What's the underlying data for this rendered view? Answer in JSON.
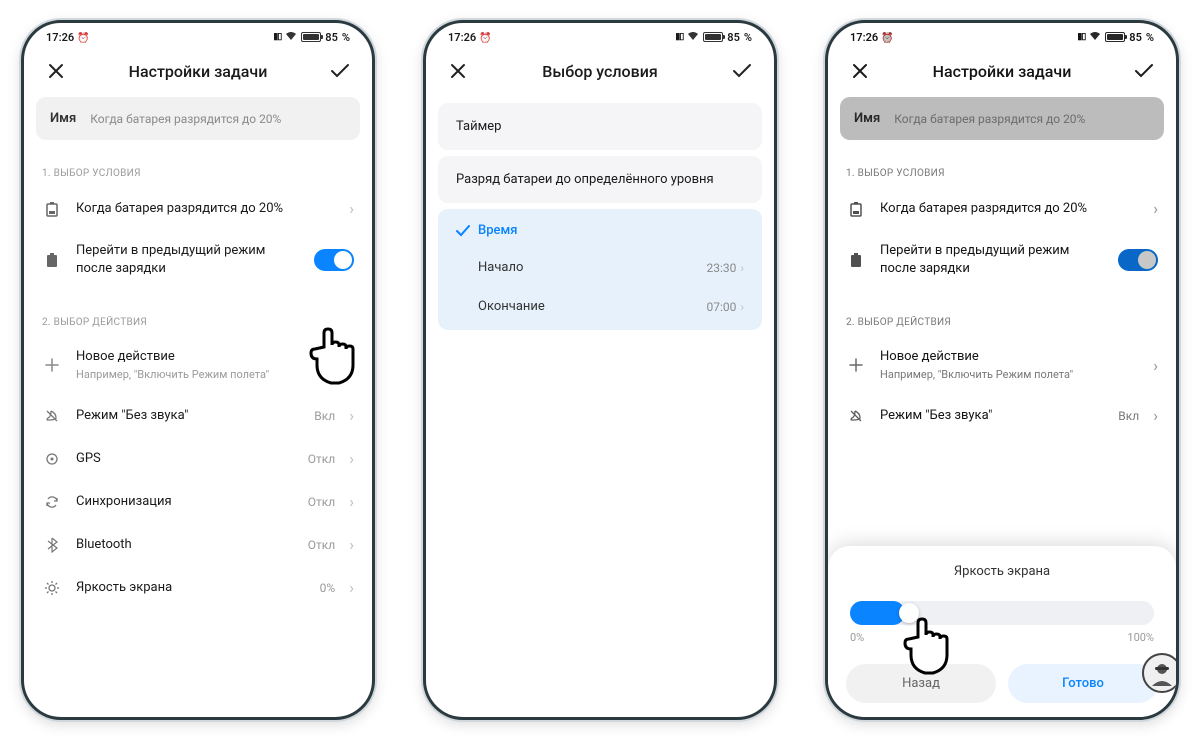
{
  "status": {
    "time": "17:26",
    "battery_pct": "85",
    "battery_suffix": "%"
  },
  "screen1": {
    "title": "Настройки задачи",
    "name_label": "Имя",
    "name_value": "Когда батарея разрядится до 20%",
    "section1": "1. ВЫБОР УСЛОВИЯ",
    "cond_text": "Когда батарея разрядится до 20%",
    "revert_text": "Перейти в предыдущий режим после зарядки",
    "section2": "2. ВЫБОР ДЕЙСТВИЯ",
    "new_action": "Новое действие",
    "new_action_sub": "Например, \"Включить Режим полета\"",
    "rows": [
      {
        "icon": "mute",
        "label": "Режим \"Без звука\"",
        "val": "Вкл"
      },
      {
        "icon": "gps",
        "label": "GPS",
        "val": "Откл"
      },
      {
        "icon": "sync",
        "label": "Синхронизация",
        "val": "Откл"
      },
      {
        "icon": "bt",
        "label": "Bluetooth",
        "val": "Откл"
      },
      {
        "icon": "bright",
        "label": "Яркость экрана",
        "val": "0%"
      }
    ]
  },
  "screen2": {
    "title": "Выбор условия",
    "opt_timer": "Таймер",
    "opt_batt": "Разряд батареи до определённого уровня",
    "opt_time": "Время",
    "start_label": "Начало",
    "start_val": "23:30",
    "end_label": "Окончание",
    "end_val": "07:00"
  },
  "screen3": {
    "title": "Настройки задачи",
    "name_label": "Имя",
    "name_value": "Когда батарея разрядится до 20%",
    "section1": "1. ВЫБОР УСЛОВИЯ",
    "cond_text": "Когда батарея разрядится до 20%",
    "revert_text": "Перейти в предыдущий режим после зарядки",
    "section2": "2. ВЫБОР ДЕЙСТВИЯ",
    "new_action": "Новое действие",
    "new_action_sub": "Например, \"Включить Режим полета\"",
    "mute_label": "Режим \"Без звука\"",
    "mute_val": "Вкл",
    "sheet_title": "Яркость экрана",
    "pct0": "0%",
    "pct100": "100%",
    "cancel": "Назад",
    "done": "Готово"
  }
}
